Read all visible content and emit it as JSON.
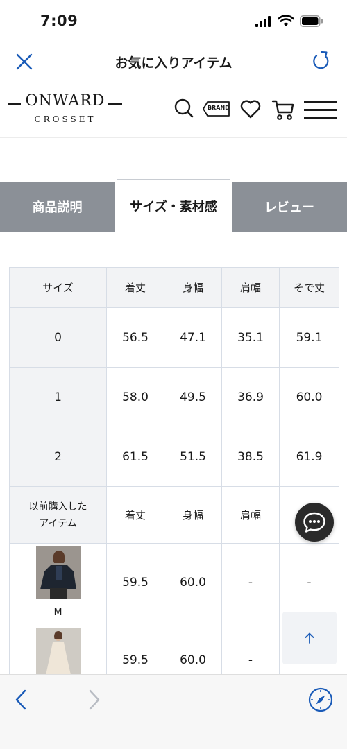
{
  "status_bar": {
    "time": "7:09"
  },
  "nav": {
    "title": "お気に入りアイテム"
  },
  "header": {
    "logo_main": "ONWARD",
    "logo_sub": "CROSSET",
    "brand_label": "BRAND"
  },
  "tabs": [
    {
      "label": "商品説明",
      "active": false
    },
    {
      "label": "サイズ・素材感",
      "active": true
    },
    {
      "label": "レビュー",
      "active": false
    }
  ],
  "size_table": {
    "headers": [
      "サイズ",
      "着丈",
      "身幅",
      "肩幅",
      "そで丈"
    ],
    "rows": [
      {
        "size": "0",
        "values": [
          "56.5",
          "47.1",
          "35.1",
          "59.1"
        ]
      },
      {
        "size": "1",
        "values": [
          "58.0",
          "49.5",
          "36.9",
          "60.0"
        ]
      },
      {
        "size": "2",
        "values": [
          "61.5",
          "51.5",
          "38.5",
          "61.9"
        ]
      }
    ],
    "previous_header": {
      "label_line1": "以前購入した",
      "label_line2": "アイテム",
      "cols": [
        "着丈",
        "身幅",
        "肩幅"
      ]
    },
    "previous_items": [
      {
        "size": "M",
        "values": [
          "59.5",
          "60.0",
          "-",
          "-"
        ]
      },
      {
        "size": "",
        "values": [
          "59.5",
          "60.0",
          "-",
          ""
        ]
      }
    ]
  },
  "colors": {
    "tab_inactive": "#8b9097",
    "accent_blue": "#1a5bb8",
    "table_border": "#d7dde6"
  }
}
